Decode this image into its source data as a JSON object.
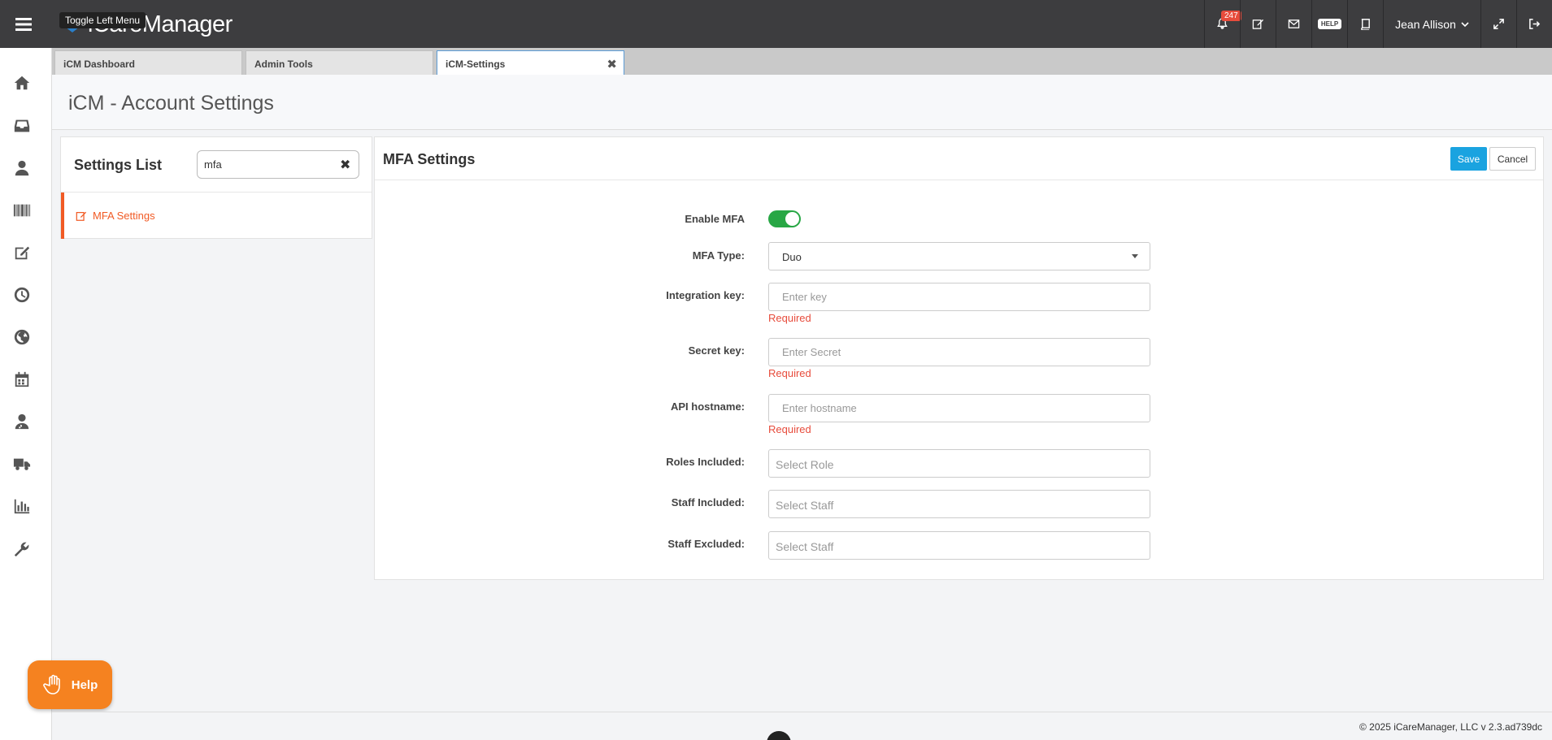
{
  "header": {
    "tooltip": "Toggle Left Menu",
    "logo_text": "iCareManager",
    "notification_count": "247",
    "help_label": "HELP",
    "user_name": "Jean Allison"
  },
  "sidebar": {
    "icons": [
      "home-icon",
      "inbox-icon",
      "user-icon",
      "barcode-icon",
      "edit-icon",
      "clock-icon",
      "globe-icon",
      "calendar-icon",
      "user-doctor-icon",
      "truck-icon",
      "bar-chart-icon",
      "wrench-icon"
    ]
  },
  "tabs": [
    {
      "label": "iCM Dashboard",
      "active": false
    },
    {
      "label": "Admin Tools",
      "active": false
    },
    {
      "label": "iCM-Settings",
      "active": true
    }
  ],
  "page": {
    "title": "iCM - Account Settings"
  },
  "settings_list": {
    "title": "Settings List",
    "search_value": "mfa",
    "items": [
      {
        "label": "MFA Settings"
      }
    ]
  },
  "mfa": {
    "title": "MFA Settings",
    "save_label": "Save",
    "cancel_label": "Cancel",
    "enable_label": "Enable MFA",
    "enabled": true,
    "type_label": "MFA Type:",
    "type_value": "Duo",
    "integration_label": "Integration key:",
    "integration_placeholder": "Enter key",
    "secret_label": "Secret key:",
    "secret_placeholder": "Enter Secret",
    "hostname_label": "API hostname:",
    "hostname_placeholder": "Enter hostname",
    "required_text": "Required",
    "roles_label": "Roles Included:",
    "roles_placeholder": "Select Role",
    "staff_included_label": "Staff Included:",
    "staff_included_placeholder": "Select Staff",
    "staff_excluded_label": "Staff Excluded:",
    "staff_excluded_placeholder": "Select Staff"
  },
  "footer": {
    "copyright": "© 2025 iCareManager, LLC v 2.3.ad739dc"
  },
  "help_widget": {
    "label": "Help"
  },
  "colors": {
    "topbar": "#3d3d3f",
    "accent": "#f15a24",
    "primary_button": "#1aa3e0",
    "toggle_on": "#28a745",
    "error": "#e74c3c",
    "help_widget": "#f58220"
  }
}
